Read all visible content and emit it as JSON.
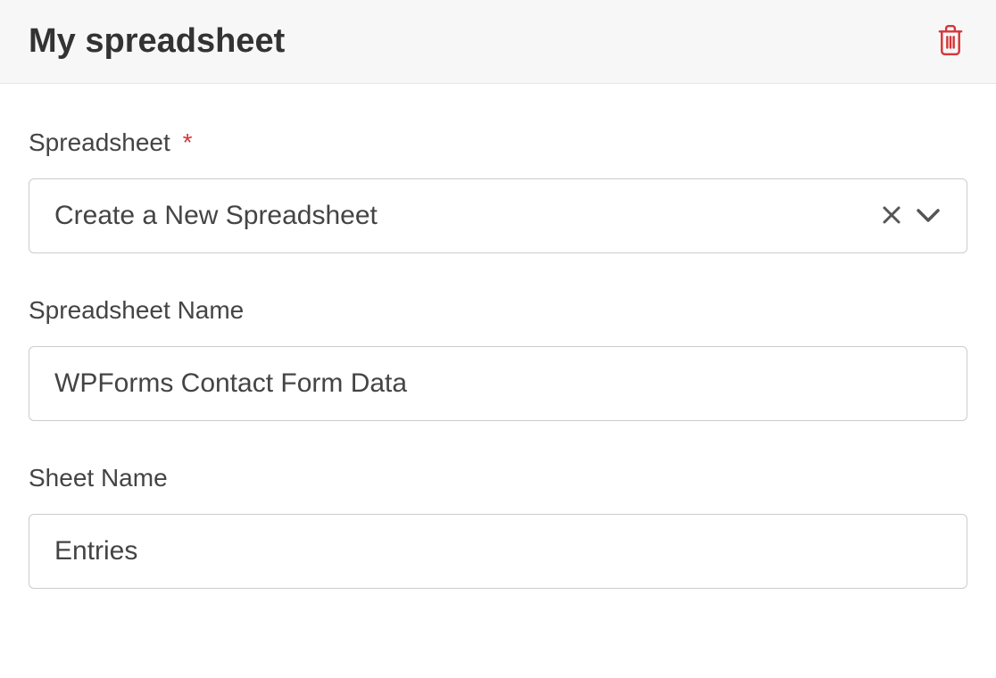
{
  "header": {
    "title": "My spreadsheet"
  },
  "fields": {
    "spreadsheet": {
      "label": "Spreadsheet",
      "required_mark": "*",
      "selected": "Create a New Spreadsheet"
    },
    "spreadsheet_name": {
      "label": "Spreadsheet Name",
      "value": "WPForms Contact Form Data"
    },
    "sheet_name": {
      "label": "Sheet Name",
      "value": "Entries"
    }
  }
}
